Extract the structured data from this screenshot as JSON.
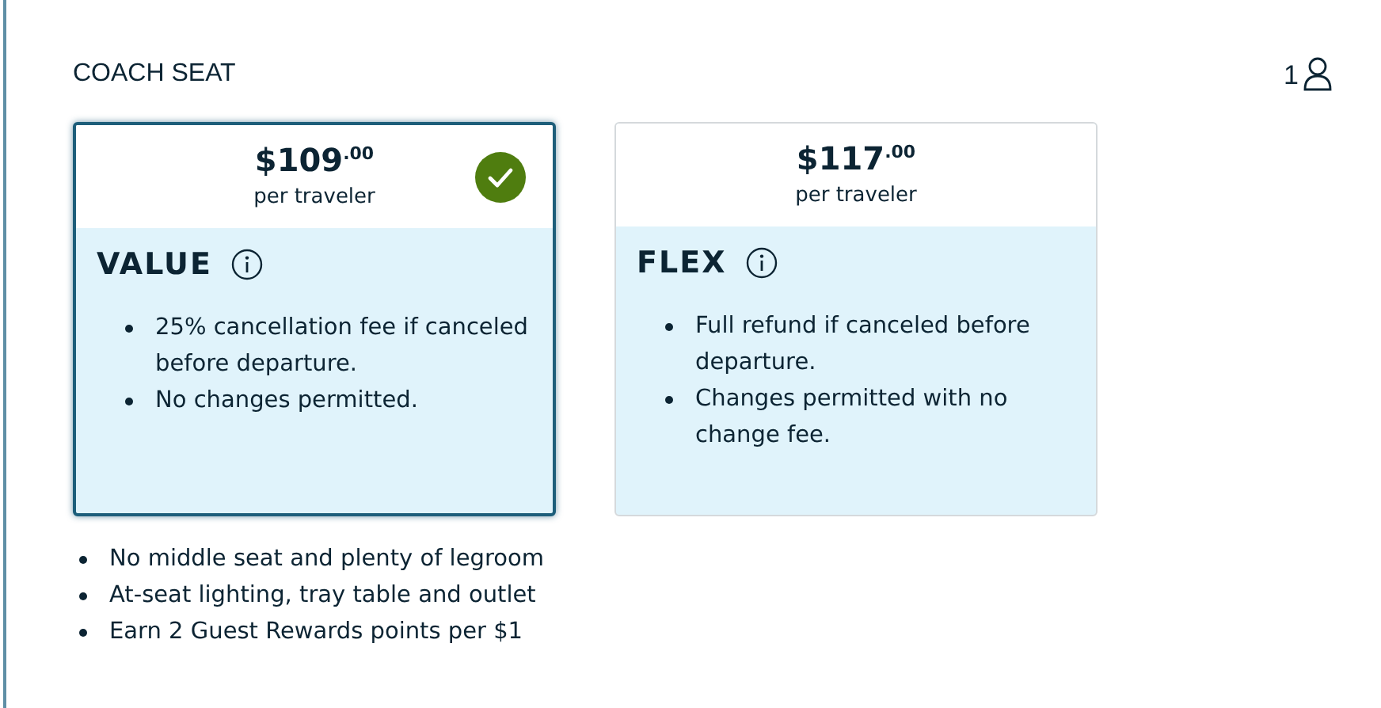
{
  "section": {
    "title": "COACH SEAT",
    "traveler_count": "1"
  },
  "fares": [
    {
      "price": "$109$^{.00}$",
      "unit": "per traveler",
      "name": "VALUE",
      "selected": true,
      "terms": [
        "25% cancellation fee if canceled before departure.",
        "No changes permitted."
      ]
    },
    {
      "price": "$117$^{.00}$",
      "unit": "per traveler",
      "name": "FLEX",
      "selected": false,
      "terms": [
        "Full refund if canceled before departure.",
        "Changes permitted with no change fee."
      ]
    }
  ],
  "features": [
    "No middle seat and plenty of legroom",
    "At-seat lighting, tray table and outlet",
    "Earn 2 Guest Rewards points per $1"
  ]
}
